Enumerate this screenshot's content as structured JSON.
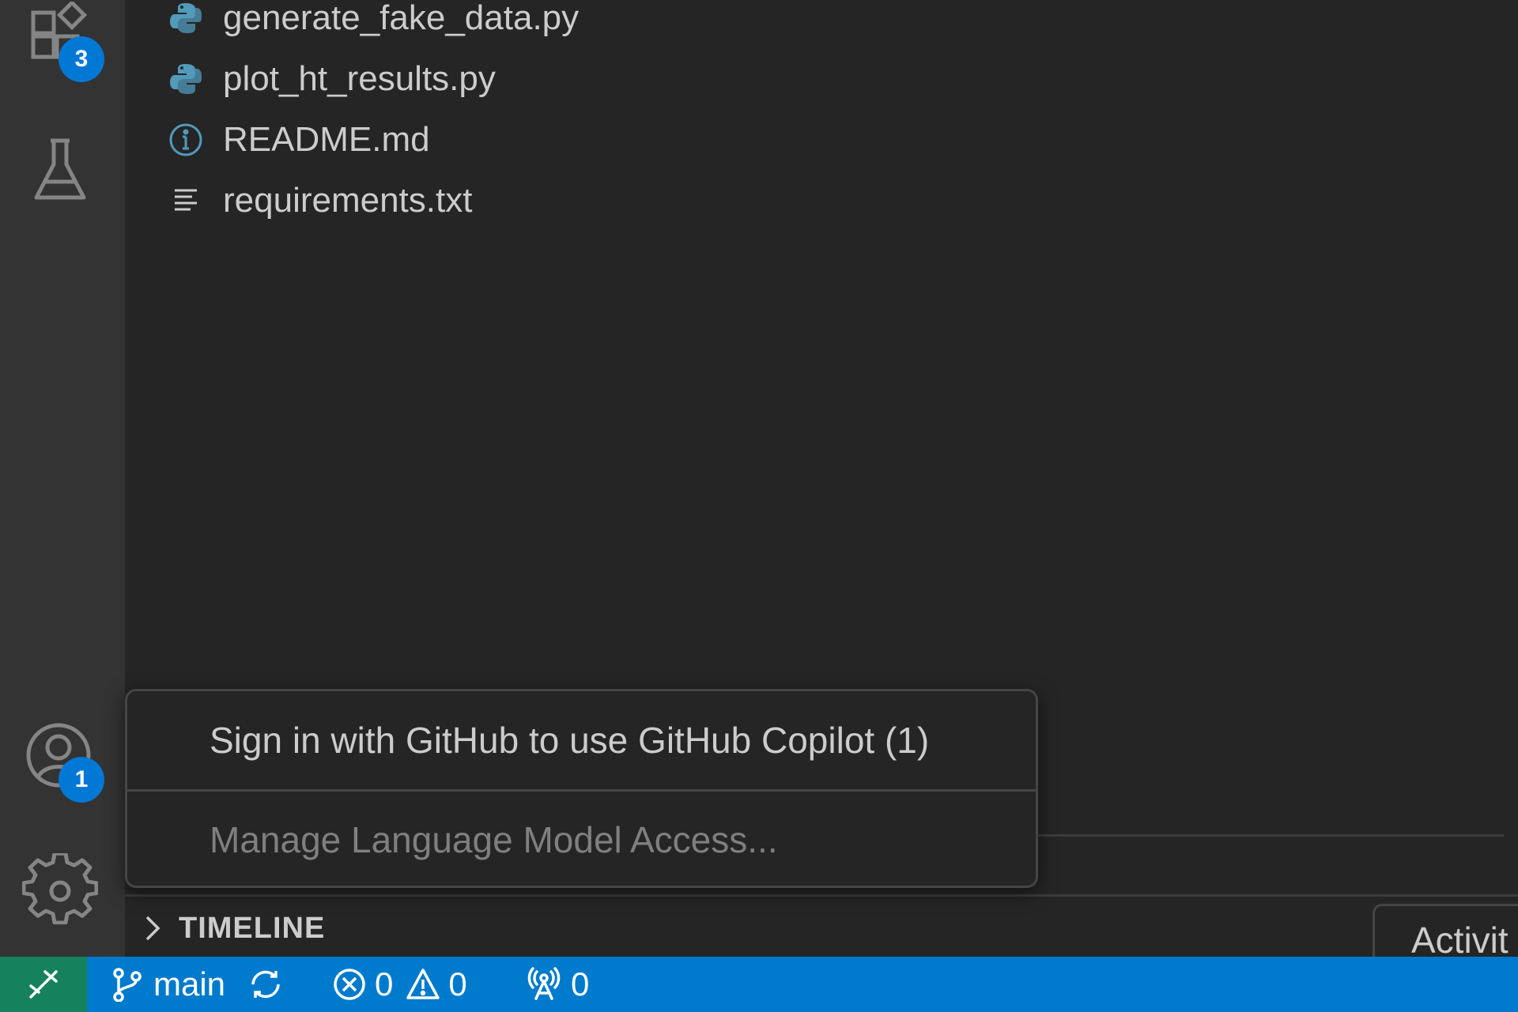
{
  "explorer": {
    "files": [
      {
        "name": "generate_fake_data.py",
        "icon": "python-file-icon"
      },
      {
        "name": "plot_ht_results.py",
        "icon": "python-file-icon"
      },
      {
        "name": "README.md",
        "icon": "info-file-icon"
      },
      {
        "name": "requirements.txt",
        "icon": "text-file-icon"
      }
    ]
  },
  "activity_bar": {
    "extensions_badge": "3",
    "accounts_badge": "1"
  },
  "accounts_menu": {
    "items": [
      {
        "label": "Sign in with GitHub to use GitHub Copilot (1)",
        "enabled": true
      },
      {
        "label": "Manage Language Model Access...",
        "enabled": false
      }
    ]
  },
  "timeline": {
    "label": "TIMELINE"
  },
  "toast": {
    "label": "Activit"
  },
  "status_bar": {
    "branch": "main",
    "errors": "0",
    "warnings": "0",
    "ports": "0"
  },
  "colors": {
    "status_bar": "#007acc",
    "remote": "#16825d",
    "badge": "#0078d4",
    "python_icon": "#519aba"
  }
}
